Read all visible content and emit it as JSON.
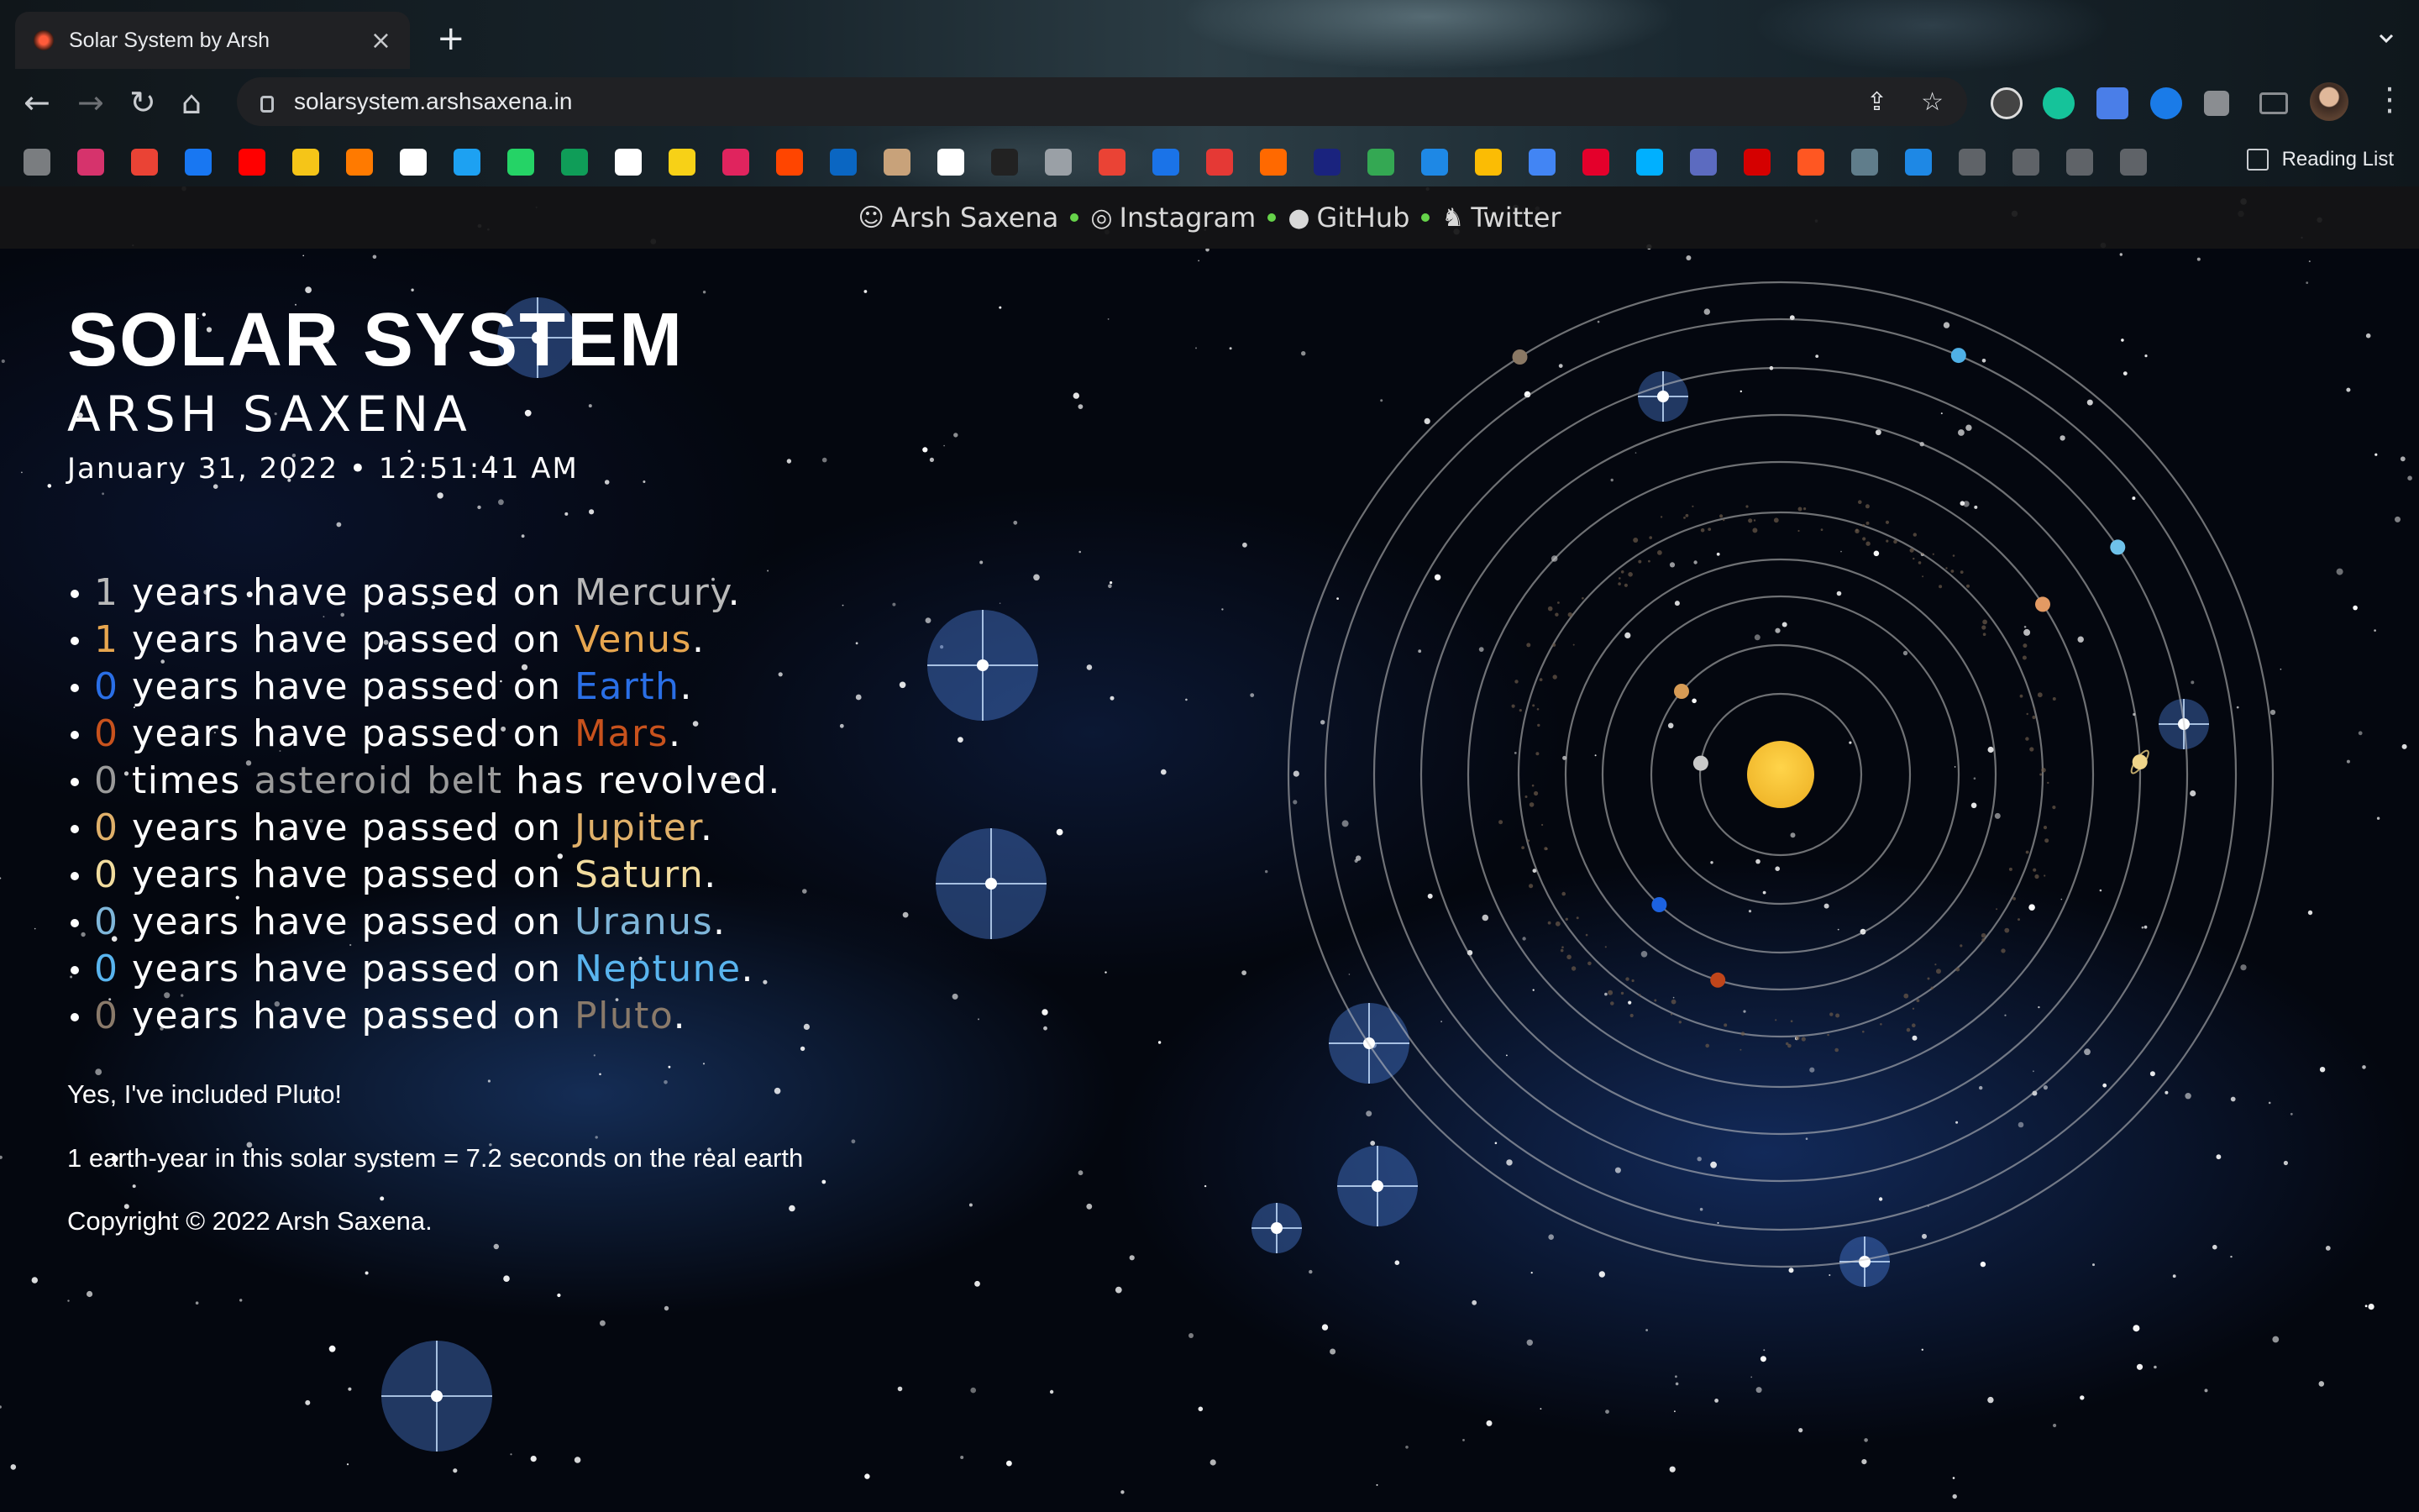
{
  "browser": {
    "tab_title": "Solar System by Arsh",
    "tab_close": "×",
    "new_tab": "+",
    "url": "solarsystem.arshsaxena.in",
    "reading_list": "Reading List",
    "nav": {
      "back": "←",
      "forward": "→",
      "reload": "↻",
      "home": "⌂"
    },
    "omnibox_icons": {
      "share": "⇪",
      "bookmark": "☆"
    },
    "menu": "⋮"
  },
  "topnav": {
    "items": [
      {
        "label": "Arsh Saxena",
        "icon": "person-icon"
      },
      {
        "label": "Instagram",
        "icon": "instagram-icon",
        "glyph": "◎"
      },
      {
        "label": "GitHub",
        "icon": "github-icon",
        "glyph": "●"
      },
      {
        "label": "Twitter",
        "icon": "twitter-icon",
        "glyph": "♞"
      }
    ],
    "separator_color": "#66d34a"
  },
  "header": {
    "title": "SOLAR SYSTEM",
    "subtitle": "ARSH SAXENA",
    "datetime": "January 31, 2022 • 12:51:41 AM"
  },
  "stats": [
    {
      "count": "1",
      "pre": " years have passed on ",
      "name": "Mercury",
      "post": ".",
      "count_color": "#b9b9b9",
      "name_color": "#b9b9b9"
    },
    {
      "count": "1",
      "pre": " years have passed on ",
      "name": "Venus",
      "post": ".",
      "count_color": "#e7a64f",
      "name_color": "#e7a64f"
    },
    {
      "count": "0",
      "pre": " years have passed on ",
      "name": "Earth",
      "post": ".",
      "count_color": "#2a6fe6",
      "name_color": "#2a6fe6"
    },
    {
      "count": "0",
      "pre": " years have passed on ",
      "name": "Mars",
      "post": ".",
      "count_color": "#c8521d",
      "name_color": "#c8521d"
    },
    {
      "count": "0",
      "pre": " times ",
      "name": "asteroid belt",
      "post": " has revolved.",
      "count_color": "#9a9a9a",
      "name_color": "#9a9a9a"
    },
    {
      "count": "0",
      "pre": " years have passed on ",
      "name": "Jupiter",
      "post": ".",
      "count_color": "#e0b06a",
      "name_color": "#e0b06a"
    },
    {
      "count": "0",
      "pre": " years have passed on ",
      "name": "Saturn",
      "post": ".",
      "count_color": "#f2dc9e",
      "name_color": "#f2dc9e"
    },
    {
      "count": "0",
      "pre": " years have passed on ",
      "name": "Uranus",
      "post": ".",
      "count_color": "#7fb6d9",
      "name_color": "#7fb6d9"
    },
    {
      "count": "0",
      "pre": " years have passed on ",
      "name": "Neptune",
      "post": ".",
      "count_color": "#59b4ee",
      "name_color": "#59b4ee"
    },
    {
      "count": "0",
      "pre": " years have passed on ",
      "name": "Pluto",
      "post": ".",
      "count_color": "#8a7a6a",
      "name_color": "#8a7a6a"
    }
  ],
  "notes": {
    "pluto": "Yes, I've included Pluto!",
    "scale": "1 earth-year in this solar system = 7.2 seconds on the real earth",
    "copyright": "Copyright © 2022 Arsh Saxena."
  },
  "solar": {
    "sun_color": "#f0b62a",
    "orbit_color": "rgba(200,200,200,0.55)",
    "planets": [
      {
        "name": "mercury",
        "color": "#c9c9c9",
        "angle_deg": 188
      },
      {
        "name": "venus",
        "color": "#d79b55",
        "angle_deg": 220
      },
      {
        "name": "earth",
        "color": "#1c62e0",
        "angle_deg": 133
      },
      {
        "name": "mars",
        "color": "#c0451a",
        "angle_deg": 107
      },
      {
        "name": "jupiter",
        "color": "#e39a63",
        "angle_deg": 327
      },
      {
        "name": "saturn",
        "color": "#f0d58a",
        "angle_deg": 358
      },
      {
        "name": "uranus",
        "color": "#6fc2ea",
        "angle_deg": 326
      },
      {
        "name": "neptune",
        "color": "#4fb0e6",
        "angle_deg": 293
      },
      {
        "name": "pluto",
        "color": "#8a7864",
        "angle_deg": 238
      }
    ]
  }
}
